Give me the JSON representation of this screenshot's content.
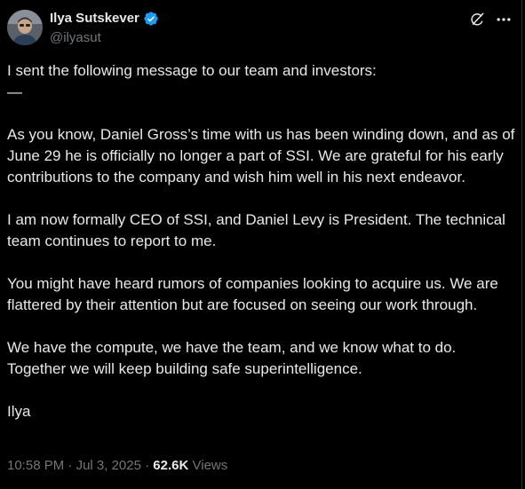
{
  "colors": {
    "background": "#000000",
    "text": "#e7e9ea",
    "secondary": "#71767b",
    "verified_blue": "#1d9bf0"
  },
  "author": {
    "display_name": "Ilya Sutskever",
    "handle": "@ilyasut",
    "verified": true,
    "avatar_icon": "avatar"
  },
  "header_icons": [
    "grok-icon",
    "more-options-icon"
  ],
  "post": {
    "paragraphs": [
      [
        "I sent the following message to our team and investors:",
        "—"
      ],
      [
        "As you know, Daniel Gross’s time with us has been winding down, and as of June 29 he is officially no longer a part of SSI. We are grateful for his early contributions to the company and wish him well in his next endeavor."
      ],
      [
        "I am now formally CEO of SSI, and Daniel Levy is President. The technical team continues to report to me."
      ],
      [
        "You might have heard rumors of companies looking to acquire us. We are flattered by their attention but are focused on seeing our work through."
      ],
      [
        "We have the compute, we have the team, and we know what to do.",
        "Together we will keep building safe superintelligence."
      ],
      [
        "Ilya"
      ]
    ]
  },
  "meta": {
    "time": "10:58 PM",
    "separator": " · ",
    "date": "Jul 3, 2025",
    "views_count": "62.6K",
    "views_label": "Views"
  }
}
